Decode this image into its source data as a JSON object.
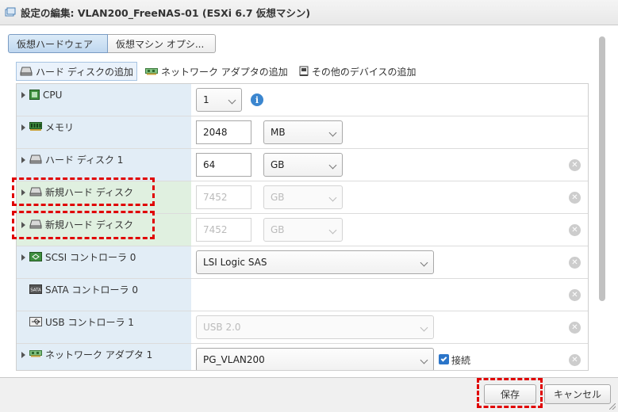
{
  "window": {
    "title": "設定の編集: VLAN200_FreeNAS-01 (ESXi 6.7 仮想マシン)"
  },
  "tabs": [
    {
      "label": "仮想ハードウェア",
      "active": true
    },
    {
      "label": "仮想マシン オプシ...",
      "active": false
    }
  ],
  "add_toolbar": {
    "add_hard_disk": "ハード ディスクの追加",
    "add_network_adapter": "ネットワーク アダプタの追加",
    "add_other_device": "その他のデバイスの追加"
  },
  "devices": {
    "cpu": {
      "label": "CPU",
      "value": "1"
    },
    "memory": {
      "label": "メモリ",
      "value": "2048",
      "unit": "MB"
    },
    "hdd1": {
      "label": "ハード ディスク 1",
      "value": "64",
      "unit": "GB"
    },
    "new_hdd_a": {
      "label": "新規ハード ディスク",
      "placeholder": "7452",
      "unit": "GB"
    },
    "new_hdd_b": {
      "label": "新規ハード ディスク",
      "placeholder": "7452",
      "unit": "GB"
    },
    "scsi": {
      "label": "SCSI コントローラ 0",
      "value": "LSI Logic SAS"
    },
    "sata": {
      "label": "SATA コントローラ 0"
    },
    "usb": {
      "label": "USB コントローラ 1",
      "value": "USB 2.0"
    },
    "nic": {
      "label": "ネットワーク アダプタ 1",
      "value": "PG_VLAN200",
      "connect_label": "接続",
      "connected": true
    }
  },
  "footer": {
    "save_label": "保存",
    "cancel_label": "キャンセル"
  },
  "colors": {
    "highlight": "#e00000",
    "accent": "#3b86cf",
    "label_bg": "#e2edf6",
    "new_label_bg": "#e0f0e0"
  }
}
